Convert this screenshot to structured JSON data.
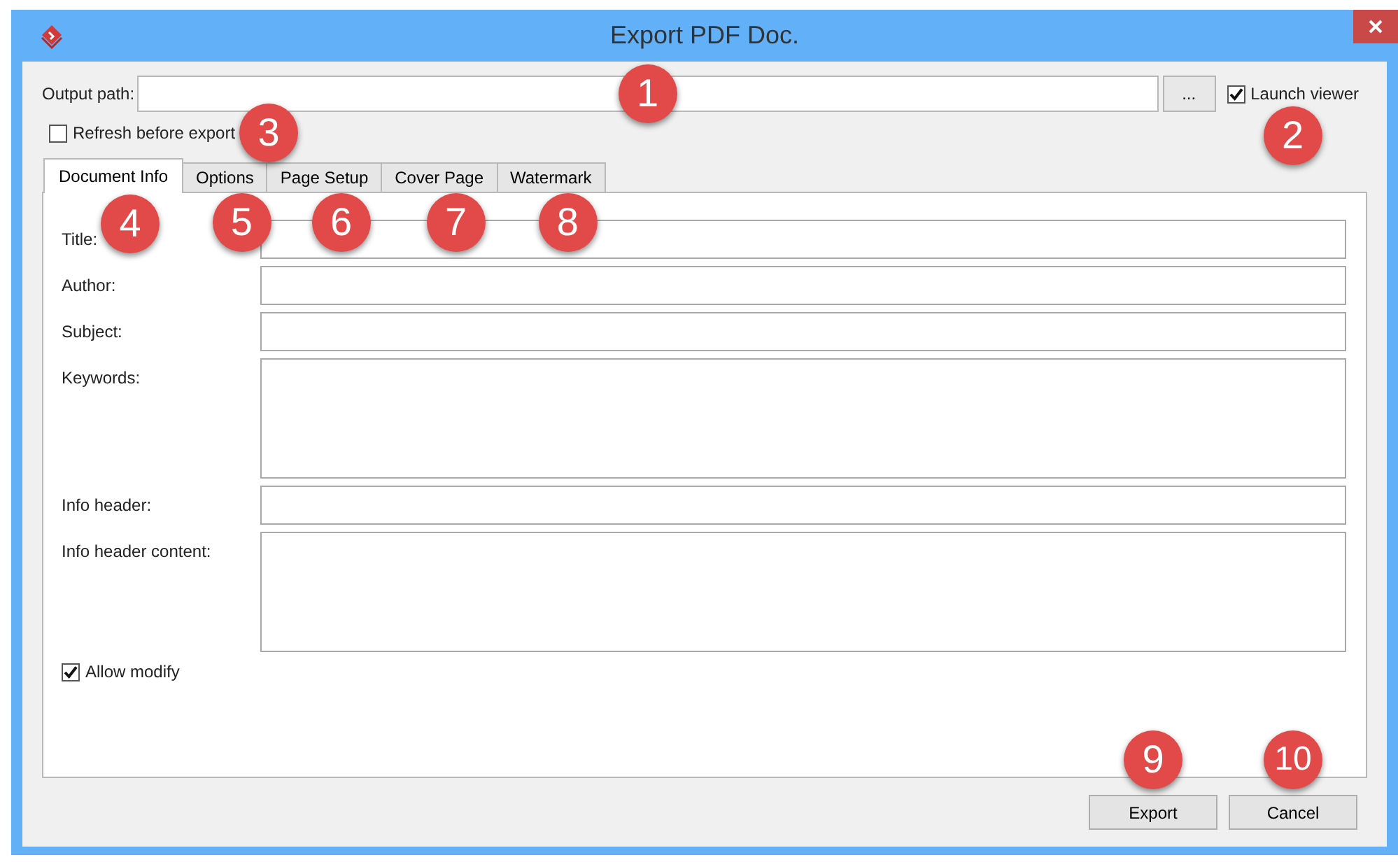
{
  "window": {
    "title": "Export PDF Doc."
  },
  "output_path": {
    "label": "Output path:",
    "callout": "1"
  },
  "browse_button": {
    "label": "..."
  },
  "launch_viewer": {
    "label": "Launch viewer",
    "checked": true,
    "callout": "2"
  },
  "refresh_before_export": {
    "label": "Refresh before export",
    "checked": false,
    "callout": "3"
  },
  "tabs": [
    {
      "label": "Document Info",
      "selected": true,
      "callout": "4"
    },
    {
      "label": "Options",
      "selected": false,
      "callout": "5"
    },
    {
      "label": "Page Setup",
      "selected": false,
      "callout": "6"
    },
    {
      "label": "Cover Page",
      "selected": false,
      "callout": "7"
    },
    {
      "label": "Watermark",
      "selected": false,
      "callout": "8"
    }
  ],
  "fields": [
    {
      "label": "Title:",
      "kind": "line"
    },
    {
      "label": "Author:",
      "kind": "line"
    },
    {
      "label": "Subject:",
      "kind": "line"
    },
    {
      "label": "Keywords:",
      "kind": "area"
    },
    {
      "label": "Info header:",
      "kind": "line"
    },
    {
      "label": "Info header content:",
      "kind": "area"
    }
  ],
  "allow_modify": {
    "label": "Allow modify",
    "checked": true
  },
  "buttons": [
    {
      "label": "Export",
      "callout": "9"
    },
    {
      "label": "Cancel",
      "callout": "10"
    }
  ]
}
